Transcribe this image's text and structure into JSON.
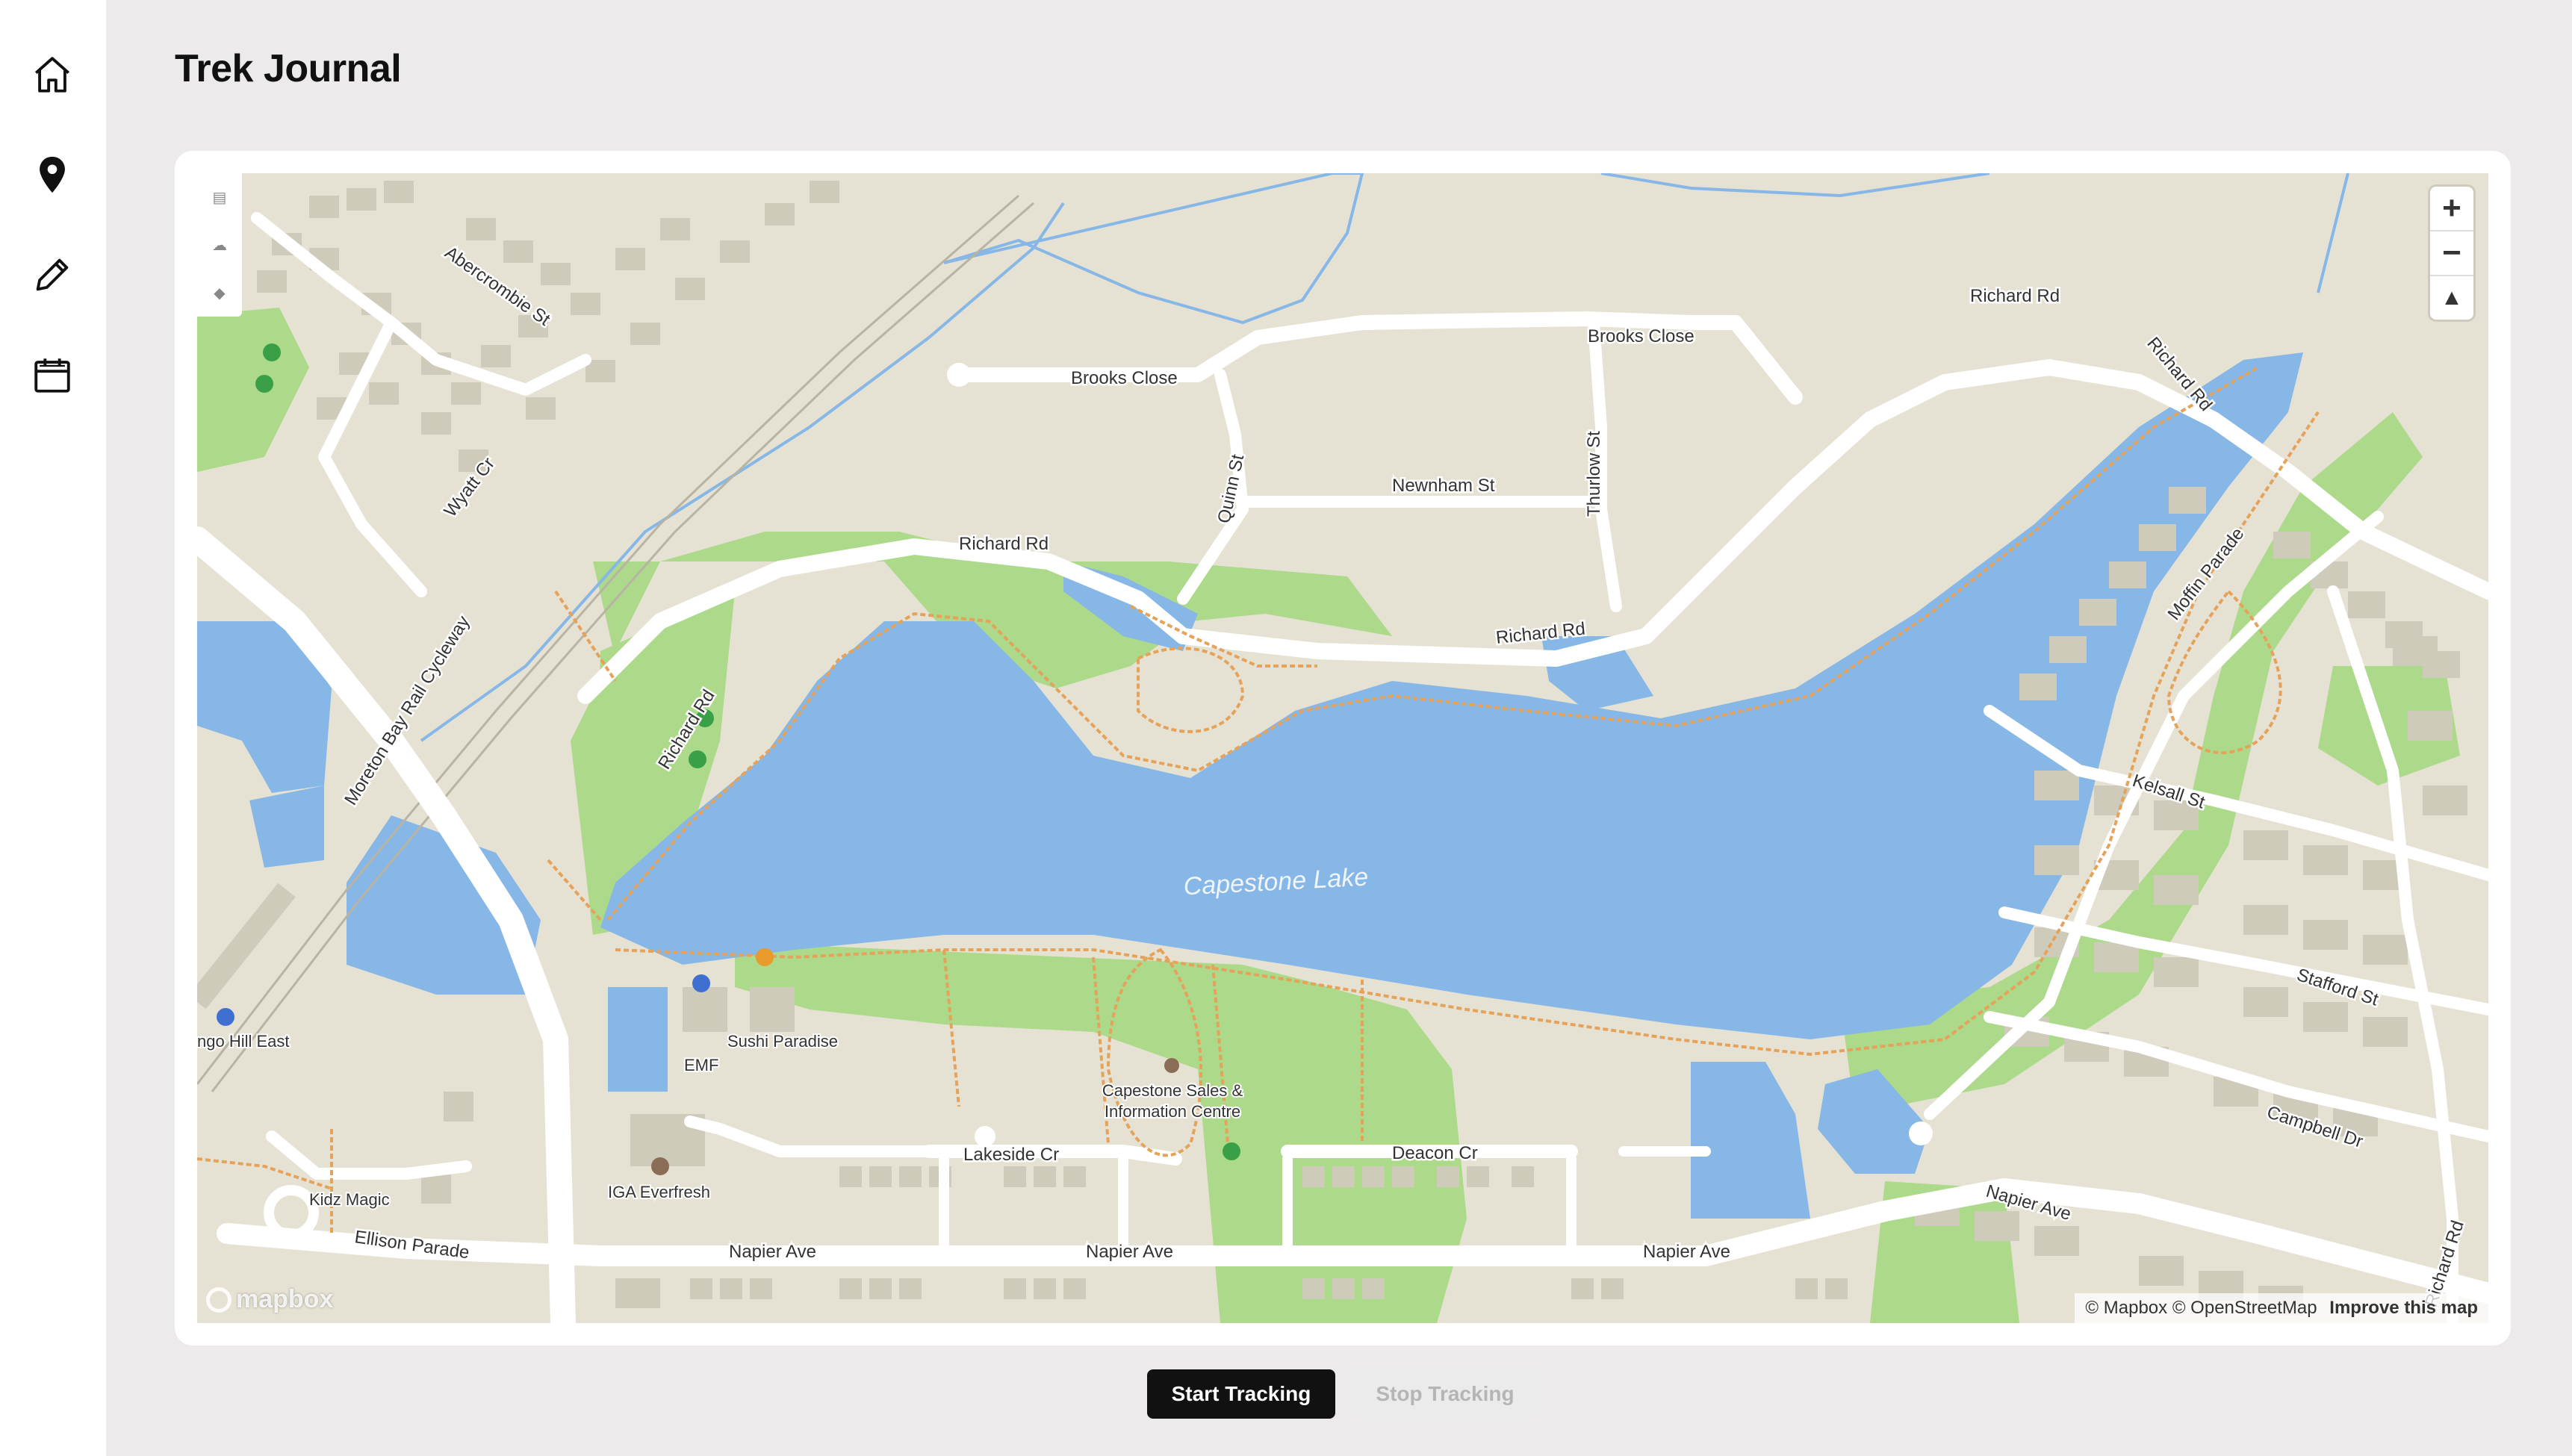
{
  "app": {
    "title": "Trek Journal"
  },
  "sidebar": {
    "items": [
      {
        "icon": "home-icon"
      },
      {
        "icon": "map-pin-icon"
      },
      {
        "icon": "pencil-icon"
      },
      {
        "icon": "calendar-icon"
      }
    ]
  },
  "map": {
    "water_name": "Capestone Lake",
    "roads": {
      "abercrombie": "Abercrombie St",
      "wyatt": "Wyatt Cr",
      "cycleway": "Moreton Bay Rail Cycleway",
      "brooks_close_1": "Brooks Close",
      "brooks_close_2": "Brooks Close",
      "richard_1": "Richard Rd",
      "richard_2": "Richard Rd",
      "richard_3": "Richard Rd",
      "richard_4": "Richard Rd",
      "richard_5": "Richard Rd",
      "richard_6": "Richard Rd",
      "quinn": "Quinn St",
      "newnham": "Newnham St",
      "thurlow": "Thurlow St",
      "moffin": "Moffin Parade",
      "kelsall": "Kelsall St",
      "stafford": "Stafford St",
      "campbell": "Campbell Dr",
      "lakeside": "Lakeside Cr",
      "deacon": "Deacon Cr",
      "napier_1": "Napier Ave",
      "napier_2": "Napier Ave",
      "napier_3": "Napier Ave",
      "napier_4": "Napier Ave",
      "ellison": "Ellison Parade"
    },
    "pois": {
      "sushi": "Sushi Paradise",
      "emf": "EMF",
      "iga": "IGA Everfresh",
      "kidz": "Kidz Magic",
      "capestone_sales_1": "Capestone Sales &",
      "capestone_sales_2": "Information Centre",
      "station": "ngo Hill East"
    },
    "controls": {
      "zoom_in": "+",
      "zoom_out": "−",
      "compass": "▲"
    },
    "attribution": {
      "mapbox": "© Mapbox",
      "osm": "© OpenStreetMap",
      "improve": "Improve this map",
      "logo": "mapbox"
    },
    "colors": {
      "land": "#e6e2d3",
      "water": "#86b7e6",
      "park": "#acd98a",
      "road": "#ffffff",
      "path": "#e5a25a",
      "building": "#cfcbbb"
    }
  },
  "actions": {
    "start": "Start Tracking",
    "stop": "Stop Tracking"
  }
}
